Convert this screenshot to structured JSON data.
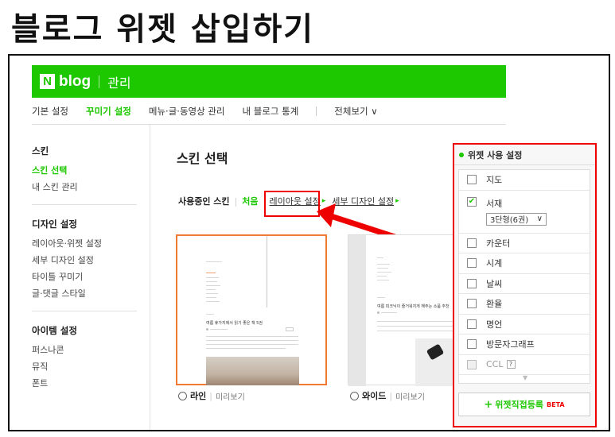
{
  "page_title": "블로그 위젯 삽입하기",
  "brand": {
    "logo_letter": "N",
    "blog": "blog",
    "manage": "관리"
  },
  "nav": {
    "items": [
      "기본 설정",
      "꾸미기 설정",
      "메뉴·글·동영상 관리",
      "내 블로그 통계"
    ],
    "all_view": "전체보기 ∨"
  },
  "sidebar": {
    "skin": {
      "title": "스킨",
      "items": [
        "스킨 선택",
        "내 스킨 관리"
      ]
    },
    "design": {
      "title": "디자인 설정",
      "items": [
        "레이아웃·위젯 설정",
        "세부 디자인 설정",
        "타이틀 꾸미기",
        "글·댓글 스타일"
      ]
    },
    "item": {
      "title": "아이템 설정",
      "items": [
        "퍼스나콘",
        "뮤직",
        "폰트"
      ]
    }
  },
  "main": {
    "title": "스킨 선택",
    "tab_using": "사용중인 스킨",
    "tab_first": "처음",
    "tab_layout": "레이아웃 설정",
    "tab_detail": "세부 디자인 설정",
    "card1": {
      "name": "라인",
      "preview": "미리보기",
      "post_title": "여름 휴가지에서 읽기 좋은 책 5권"
    },
    "card2": {
      "name": "와이드",
      "preview": "미리보기",
      "post_title": "여름 피크닉이 즐거워지게 해주는 소품 추천"
    }
  },
  "widgets": {
    "title": "위젯 사용 설정",
    "items": [
      {
        "label": "지도",
        "checked": false
      },
      {
        "label": "서재",
        "checked": true,
        "select": "3단형(6권)"
      },
      {
        "label": "카운터",
        "checked": false
      },
      {
        "label": "시계",
        "checked": false
      },
      {
        "label": "날씨",
        "checked": false
      },
      {
        "label": "환율",
        "checked": false
      },
      {
        "label": "명언",
        "checked": false
      },
      {
        "label": "방문자그래프",
        "checked": false
      },
      {
        "label": "CCL",
        "checked": false,
        "disabled": true,
        "badge": "?"
      }
    ],
    "button": "위젯직접등록",
    "button_badge": "BETA"
  },
  "colors": {
    "brand_green": "#1ec800",
    "highlight_red": "#e00000",
    "card_selected": "#f07a32"
  }
}
